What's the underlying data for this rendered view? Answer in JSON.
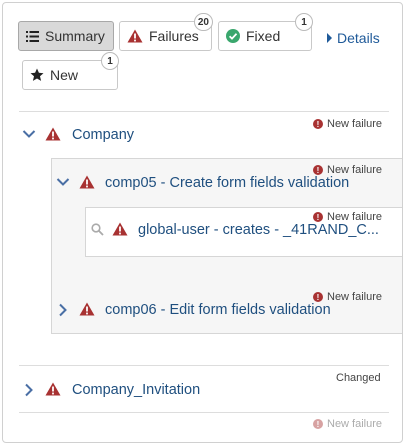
{
  "toolbar": {
    "summary_label": "Summary",
    "failures_label": "Failures",
    "failures_count": "20",
    "fixed_label": "Fixed",
    "fixed_count": "1",
    "details_label": "Details",
    "new_label": "New",
    "new_count": "1"
  },
  "tree": {
    "company": {
      "label": "Company",
      "status": "New failure"
    },
    "comp05": {
      "label": "comp05 - Create form fields validation",
      "status": "New failure"
    },
    "global_user": {
      "label": "global-user - creates - _41RAND_C...",
      "status": "New failure"
    },
    "comp06": {
      "label": "comp06 - Edit form fields validation",
      "status": "New failure"
    },
    "company_invitation": {
      "label": "Company_Invitation",
      "status": "Changed"
    },
    "next_status": "New failure"
  },
  "colors": {
    "warning_red": "#a83232",
    "link_blue": "#1f4f7f",
    "fixed_green": "#3aa76d"
  }
}
